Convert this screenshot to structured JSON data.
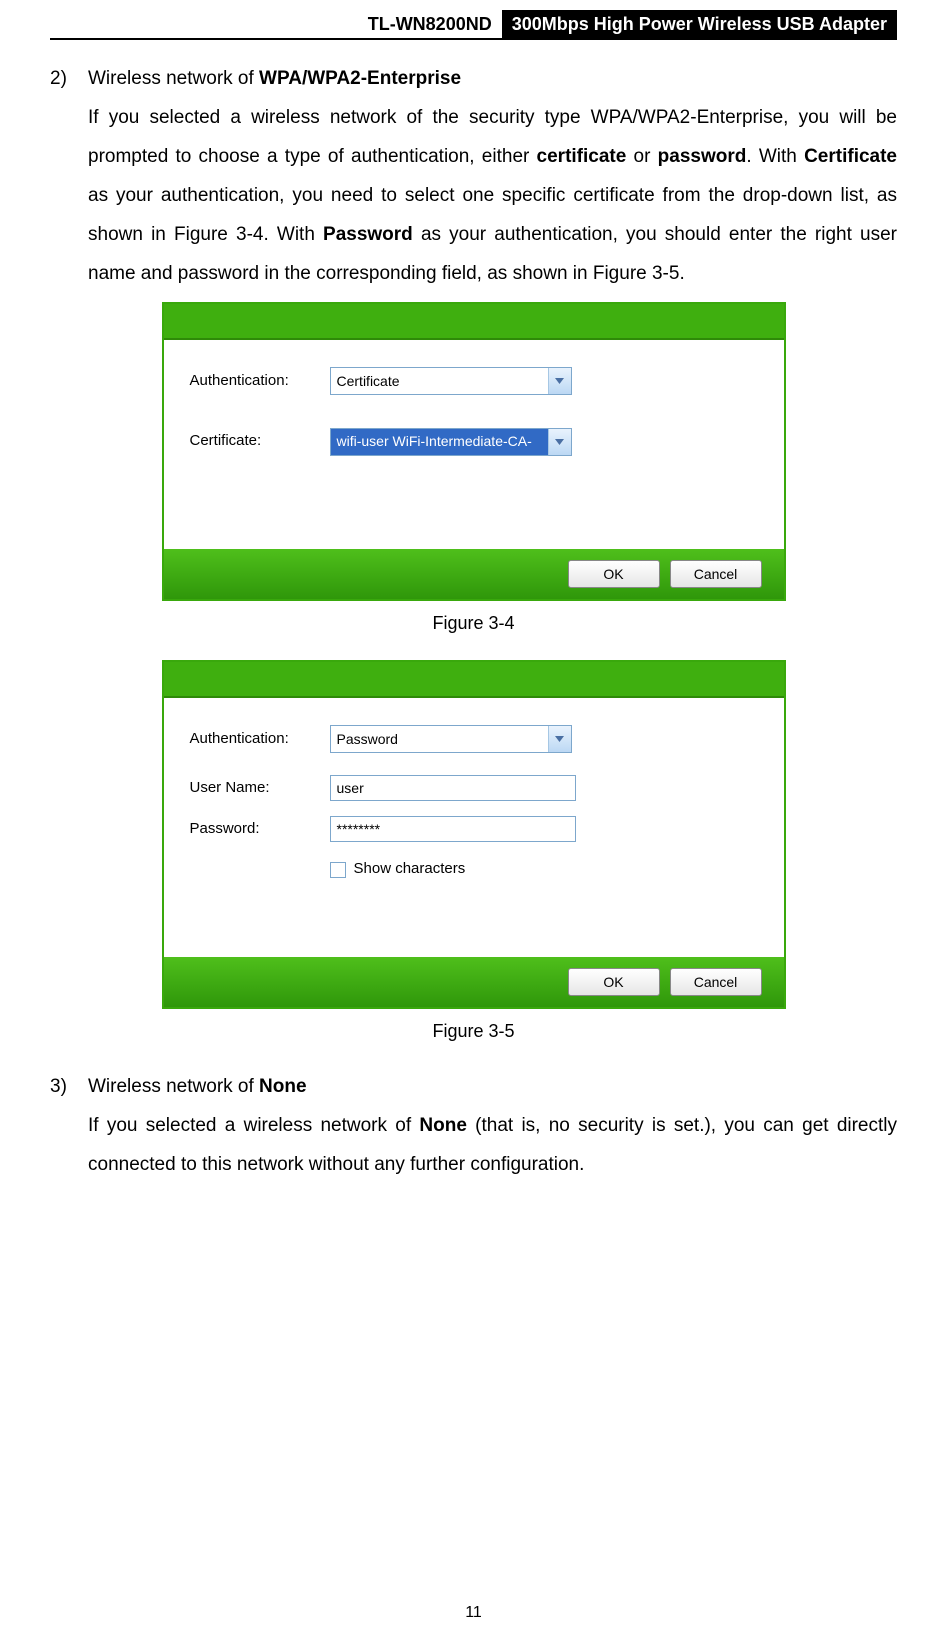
{
  "header": {
    "model": "TL-WN8200ND",
    "desc": "300Mbps High Power Wireless USB Adapter"
  },
  "section2": {
    "num": "2)",
    "title_pre": "Wireless network of ",
    "title_bold": "WPA/WPA2-Enterprise",
    "p1a": "If you selected a wireless network of the security type WPA/WPA2-Enterprise, you will be prompted to choose a type of authentication, either ",
    "p1_cert": "certificate",
    "p1b": " or ",
    "p1_pass": "password",
    "p1c": ". With ",
    "p1_Cert2": "Certificate",
    "p1d": " as your authentication, you need to select one specific certificate from the drop-down list, as shown in Figure 3-4. With ",
    "p1_Pass2": "Password",
    "p1e": " as your authentication, you should enter the right user name and password in the corresponding field, as shown in Figure 3-5."
  },
  "fig34": {
    "caption": "Figure 3-4",
    "labels": {
      "auth": "Authentication:",
      "cert": "Certificate:"
    },
    "values": {
      "auth": "Certificate",
      "cert": "wifi-user  WiFi-Intermediate-CA-"
    },
    "buttons": {
      "ok": "OK",
      "cancel": "Cancel"
    }
  },
  "fig35": {
    "caption": "Figure 3-5",
    "labels": {
      "auth": "Authentication:",
      "user": "User Name:",
      "pw": "Password:",
      "show": "Show characters"
    },
    "values": {
      "auth": "Password",
      "user": "user",
      "pw": "********"
    },
    "buttons": {
      "ok": "OK",
      "cancel": "Cancel"
    }
  },
  "section3": {
    "num": "3)",
    "title_pre": "Wireless network of ",
    "title_bold": "None",
    "p1a": "If you selected a wireless network of ",
    "p1_none": "None",
    "p1b": " (that is, no security is set.), you can get directly connected to this network without any further configuration."
  },
  "pagenum": "11"
}
